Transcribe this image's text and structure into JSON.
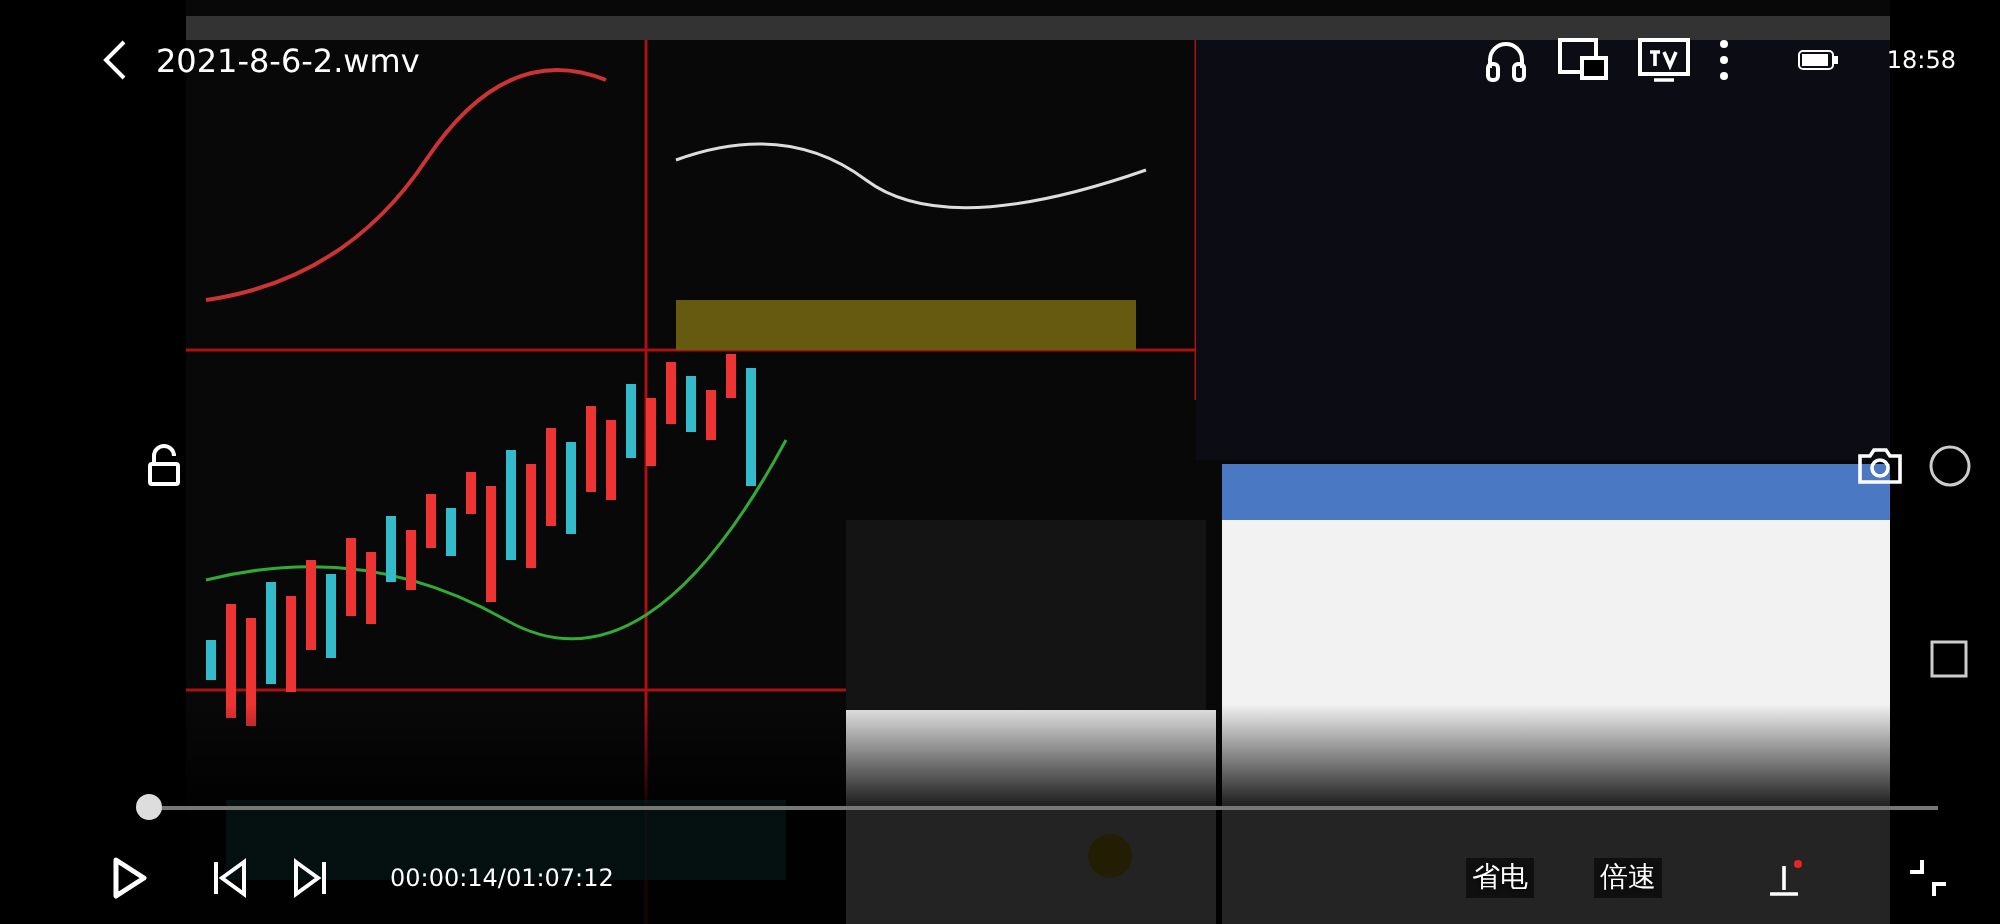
{
  "header": {
    "title": "2021-8-6-2.wmv",
    "clock": "18:58"
  },
  "player": {
    "playing": false,
    "locked": false,
    "progress": {
      "level": 0.004
    },
    "time": "00:00:14/01:07:12",
    "buttons": [
      "省电",
      "倍速"
    ]
  }
}
